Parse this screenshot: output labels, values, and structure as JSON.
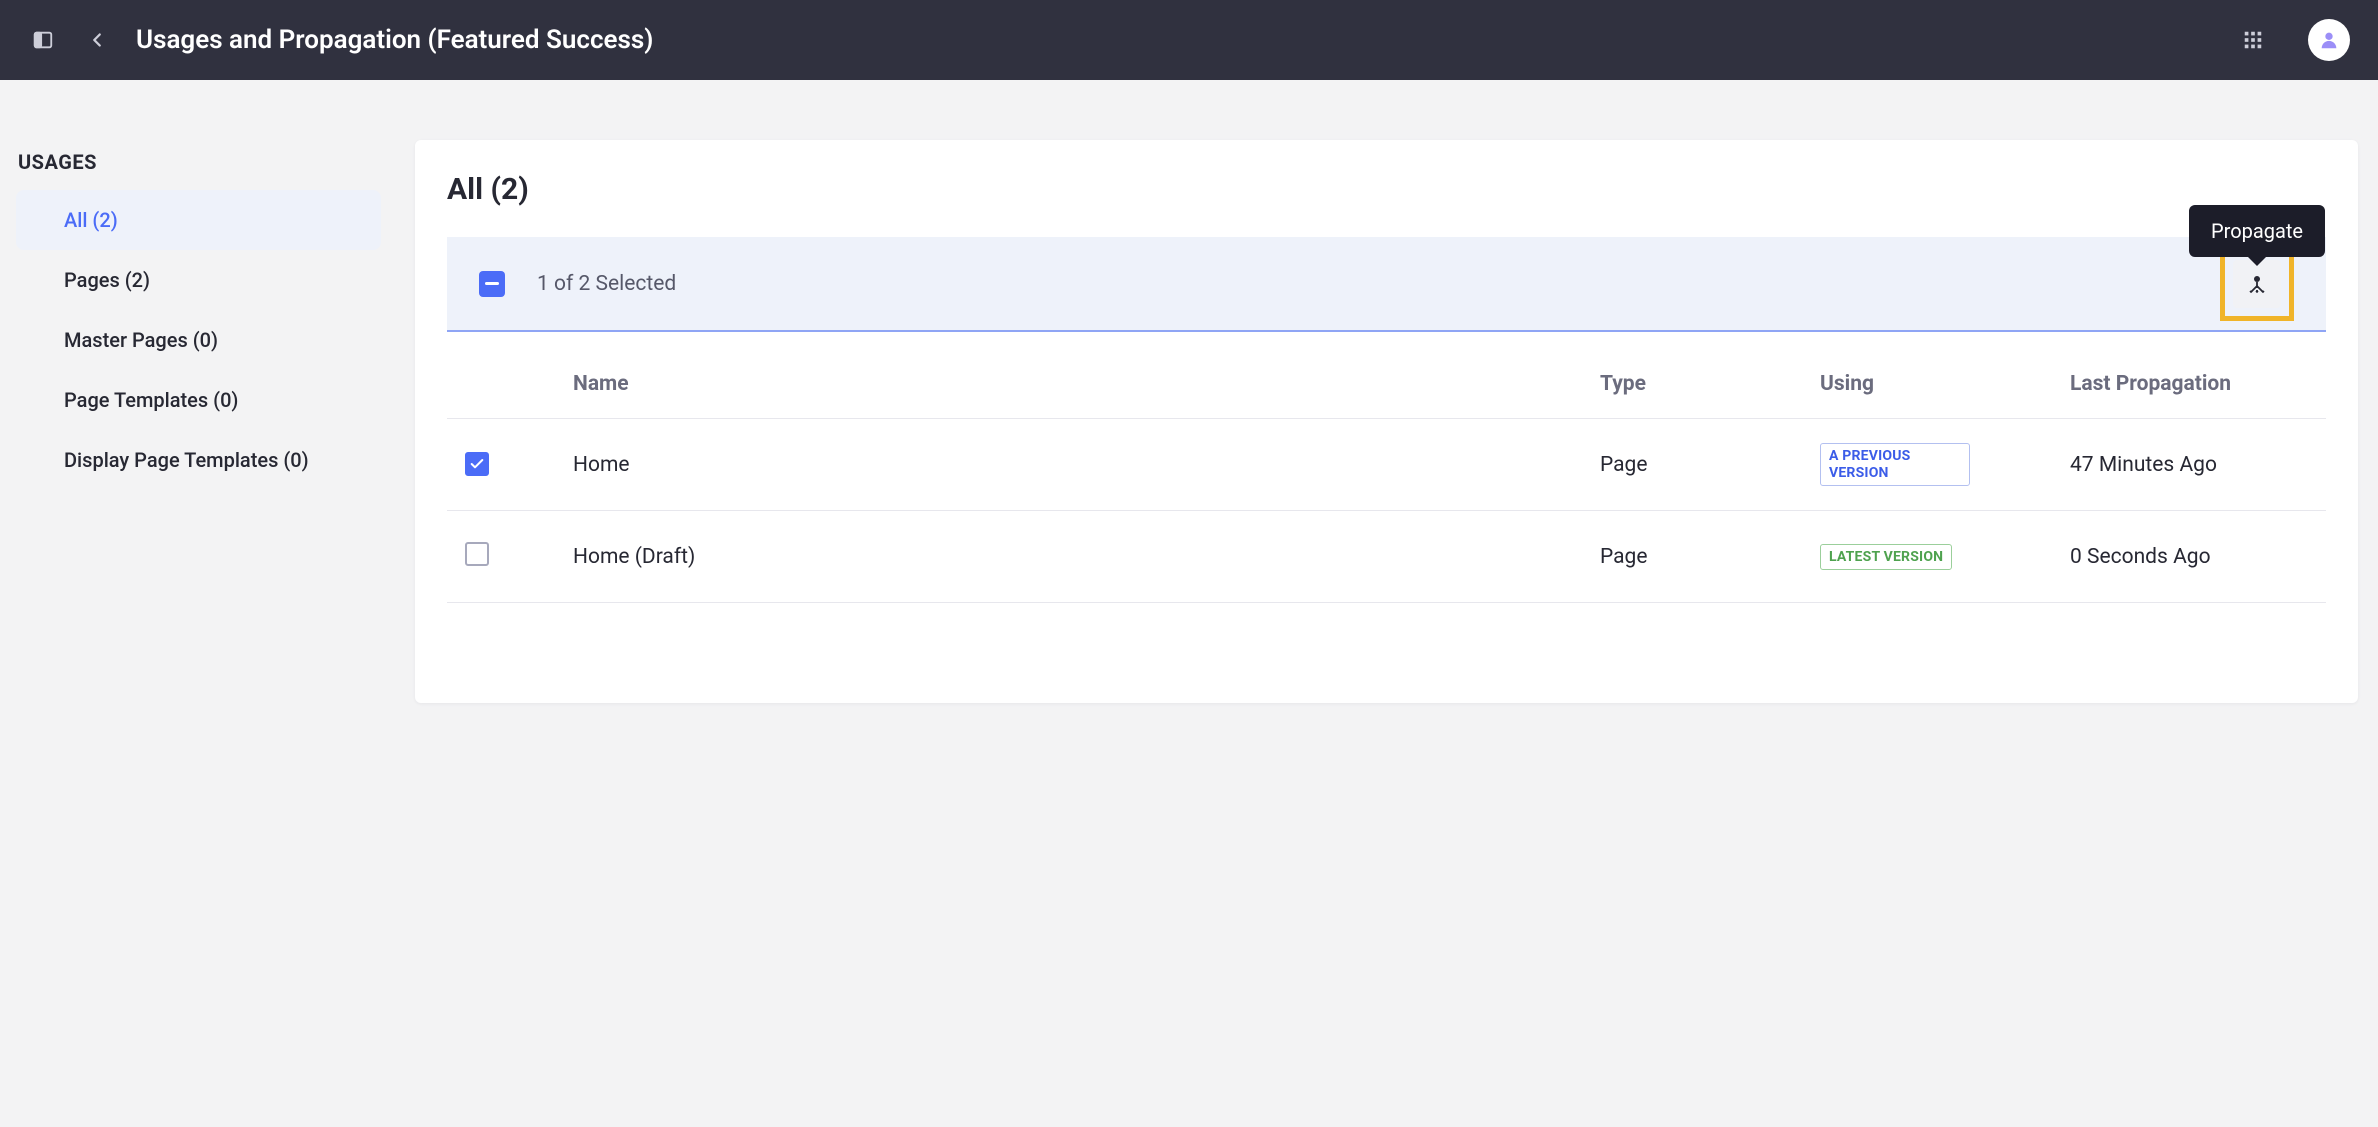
{
  "header": {
    "title": "Usages and Propagation (Featured Success)"
  },
  "sidebar": {
    "heading": "USAGES",
    "items": [
      {
        "label": "All (2)",
        "active": true
      },
      {
        "label": "Pages (2)",
        "active": false
      },
      {
        "label": "Master Pages (0)",
        "active": false
      },
      {
        "label": "Page Templates (0)",
        "active": false
      },
      {
        "label": "Display Page Templates (0)",
        "active": false
      }
    ]
  },
  "main": {
    "title": "All (2)",
    "selection_text": "1 of 2 Selected",
    "tooltip": "Propagate",
    "columns": {
      "col0": "",
      "col1": "Name",
      "col2": "Type",
      "col3": "Using",
      "col4": "Last Propagation"
    },
    "rows": [
      {
        "checked": true,
        "name": "Home",
        "type": "Page",
        "using_label": "A PREVIOUS VERSION",
        "using_class": "previous",
        "last": "47 Minutes Ago"
      },
      {
        "checked": false,
        "name": "Home (Draft)",
        "type": "Page",
        "using_label": "LATEST VERSION",
        "using_class": "latest",
        "last": "0 Seconds Ago"
      }
    ]
  }
}
